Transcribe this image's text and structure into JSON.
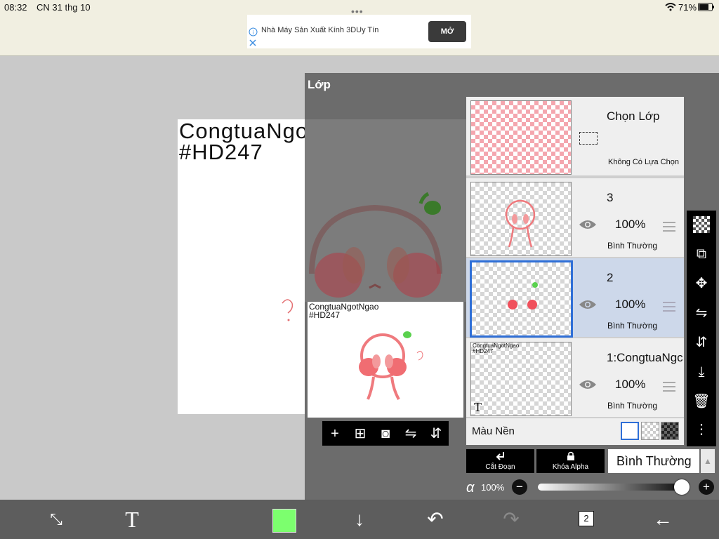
{
  "status": {
    "time": "08:32",
    "date": "CN 31 thg 10",
    "battery": "71%"
  },
  "ad": {
    "text": "Nhà Máy Sản Xuất Kính 3DUy Tín",
    "button": "MỞ"
  },
  "canvas": {
    "text_line1": "CongtuaNgotNgao",
    "text_line2": "#HD247"
  },
  "panel": {
    "title": "Lớp"
  },
  "thumb": {
    "text_line1": "CongtuaNgotNgao",
    "text_line2": "#HD247"
  },
  "layers": {
    "selection": {
      "name": "Chọn Lớp",
      "status": "Không Có Lựa Chọn"
    },
    "items": [
      {
        "name": "3",
        "opacity": "100%",
        "mode": "Bình Thường"
      },
      {
        "name": "2",
        "opacity": "100%",
        "mode": "Bình Thường"
      },
      {
        "name": "1:CongtuaNgc",
        "opacity": "100%",
        "mode": "Bình Thường",
        "thumb_text": "CongtuaNgotNgao #HD247"
      }
    ],
    "background_label": "Màu Nền"
  },
  "controls": {
    "clip_label": "Cắt Đoạn",
    "alpha_lock_label": "Khóa Alpha",
    "blend_mode": "Bình Thường",
    "alpha_value": "100%"
  },
  "bottom": {
    "layer_count": "2"
  },
  "colors": {
    "primary": "#7cff6e",
    "selection": "#2f6fd7"
  }
}
